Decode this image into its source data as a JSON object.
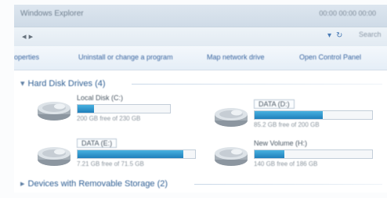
{
  "window": {
    "title": "Windows Explorer",
    "title_right": "00:00 00:00 00:00"
  },
  "address": {
    "path": "◂ ▸",
    "tools": [
      "▾",
      "↻"
    ],
    "search_placeholder": "Search"
  },
  "toolbar": {
    "items": [
      "operties",
      "Uninstall or change a program",
      "Map network drive",
      "Open Control Panel"
    ]
  },
  "groups": {
    "hard_disks": "Hard Disk Drives (4)",
    "removable": "Devices with Removable Storage (2)"
  },
  "drives": [
    {
      "name": "Local Disk (C:)",
      "free": "200 GB free of 230 GB",
      "used_fraction": 0.18,
      "boxed": false
    },
    {
      "name": "DATA (D:)",
      "free": "85.2 GB free of 200 GB",
      "used_fraction": 0.58,
      "boxed": true
    },
    {
      "name": "DATA (E:)",
      "free": "7.21 GB free of 71.5 GB",
      "used_fraction": 0.9,
      "boxed": true
    },
    {
      "name": "New Volume (H:)",
      "free": "140 GB free of 186 GB",
      "used_fraction": 0.25,
      "boxed": false
    }
  ],
  "colors": {
    "bar_fill": "#2a8ec8",
    "link": "#3a66a0",
    "group_header": "#2e5e93"
  }
}
